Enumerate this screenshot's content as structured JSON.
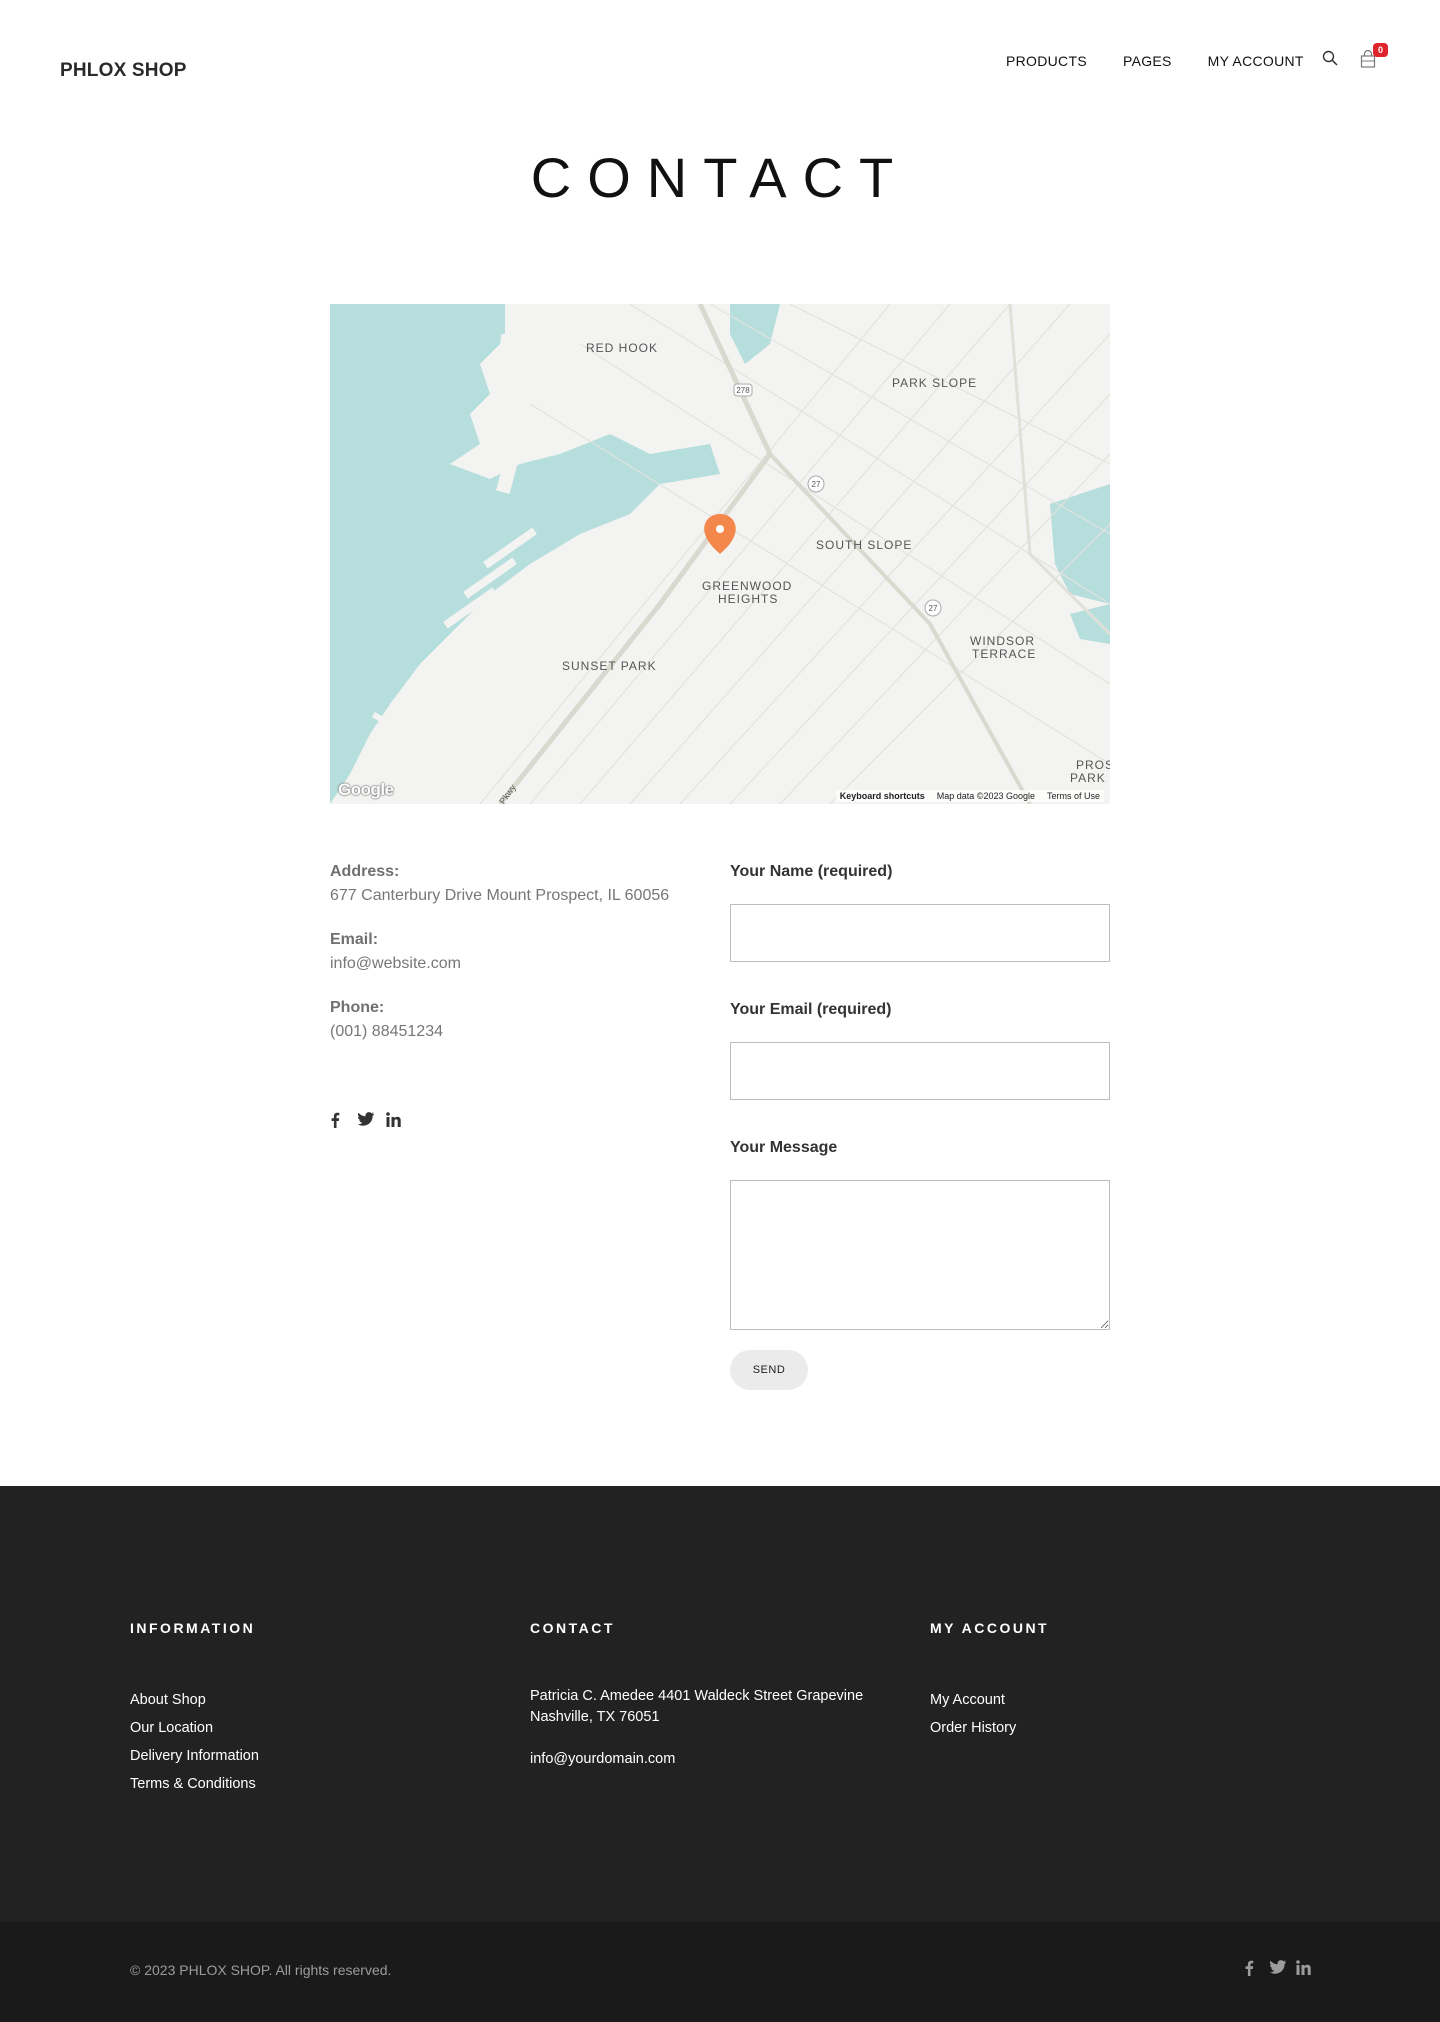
{
  "header": {
    "logo": "PHLOX SHOP",
    "nav": [
      "PRODUCTS",
      "PAGES",
      "MY ACCOUNT"
    ],
    "cart_count": "0",
    "badge_color": "#e0242b"
  },
  "page": {
    "title": "CONTACT"
  },
  "map": {
    "labels": {
      "red_hook": "RED HOOK",
      "park_slope": "PARK SLOPE",
      "south_slope": "SOUTH SLOPE",
      "greenwood_1": "GREENWOOD",
      "greenwood_2": "HEIGHTS",
      "windsor_1": "WINDSOR",
      "windsor_2": "TERRACE",
      "sunset_park": "SUNSET PARK",
      "prospect_1": "PROS",
      "prospect_2": "PARK",
      "route_278": "278",
      "route_27a": "27",
      "route_27b": "27",
      "pkwy": "Pkwy"
    },
    "google": "Google",
    "keyboard": "Keyboard shortcuts",
    "map_data": "Map data ©2023 Google",
    "terms": "Terms of Use",
    "pin_color": "#f4874b",
    "water_color": "#b5dedc"
  },
  "contact_info": {
    "address_label": "Address:",
    "address_value": "677 Canterbury Drive Mount Prospect, IL 60056",
    "email_label": "Email:",
    "email_value": "info@website.com",
    "phone_label": "Phone:",
    "phone_value": "(001) 88451234",
    "social": [
      "facebook-icon",
      "twitter-icon",
      "linkedin-icon"
    ]
  },
  "form": {
    "name_label": "Your Name (required)",
    "email_label": "Your Email (required)",
    "message_label": "Your Message",
    "send": "SEND"
  },
  "footer": {
    "information": {
      "title": "INFORMATION",
      "links": [
        "About Shop",
        "Our Location",
        "Delivery Information",
        "Terms & Conditions"
      ]
    },
    "contact": {
      "title": "CONTACT",
      "address": "Patricia C. Amedee 4401 Waldeck Street Grapevine Nashville, TX 76051",
      "email": "info@yourdomain.com"
    },
    "account": {
      "title": "MY ACCOUNT",
      "links": [
        "My Account",
        "Order History"
      ]
    },
    "copyright": "© 2023 PHLOX SHOP. All rights reserved."
  }
}
